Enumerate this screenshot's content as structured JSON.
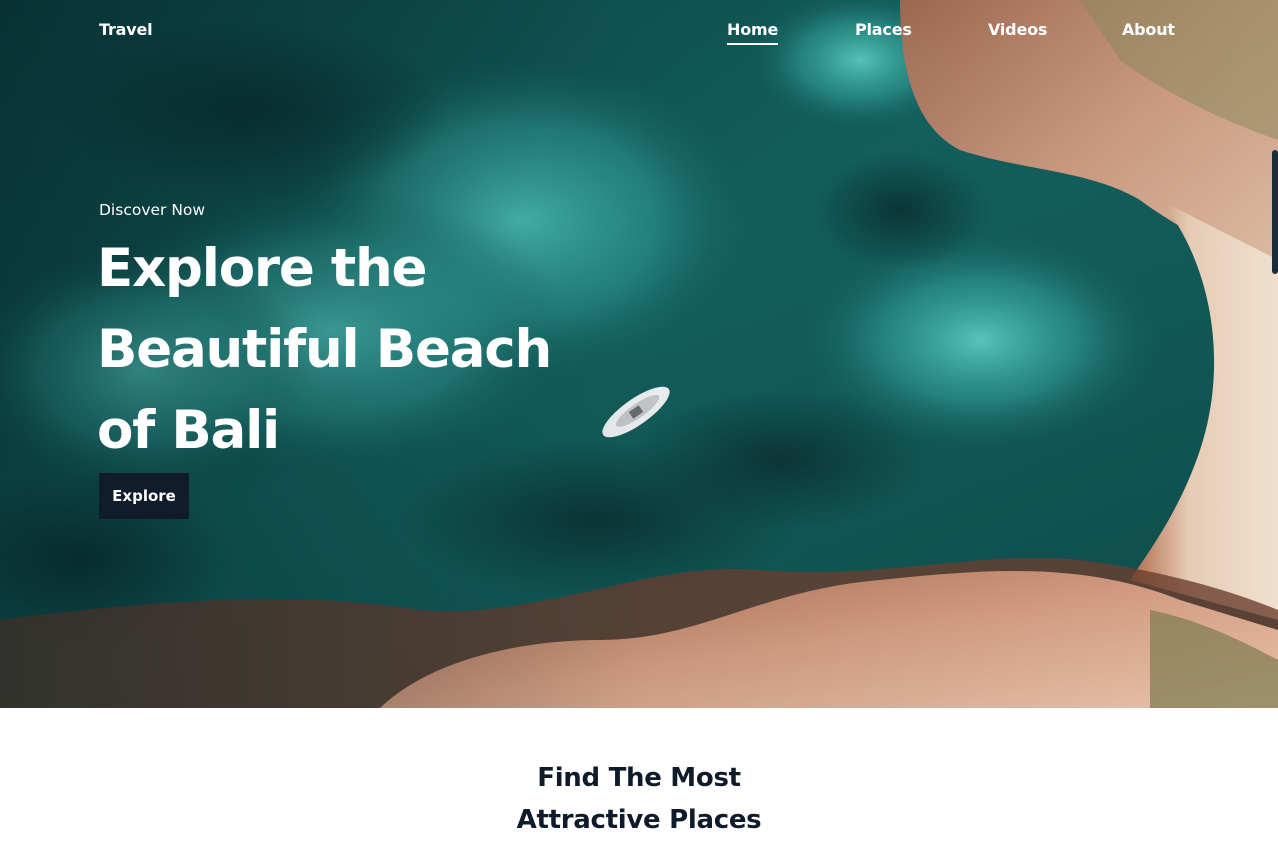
{
  "brand": "Travel",
  "nav": {
    "items": [
      {
        "label": "Home",
        "active": true
      },
      {
        "label": "Places",
        "active": false
      },
      {
        "label": "Videos",
        "active": false
      },
      {
        "label": "About",
        "active": false
      }
    ]
  },
  "hero": {
    "eyebrow": "Discover Now",
    "headline_lines": [
      "Explore the",
      "Beautiful Beach",
      "of Bali"
    ],
    "cta_label": "Explore"
  },
  "section": {
    "title_lines": [
      "Find The Most",
      "Attractive Places"
    ]
  },
  "colors": {
    "ink": "#0f1b2a",
    "cta_bg": "#111c2b",
    "sea_deep": "#0e3f40",
    "sea_shallow": "#3fb5ad",
    "rock": "#c98a6e"
  }
}
